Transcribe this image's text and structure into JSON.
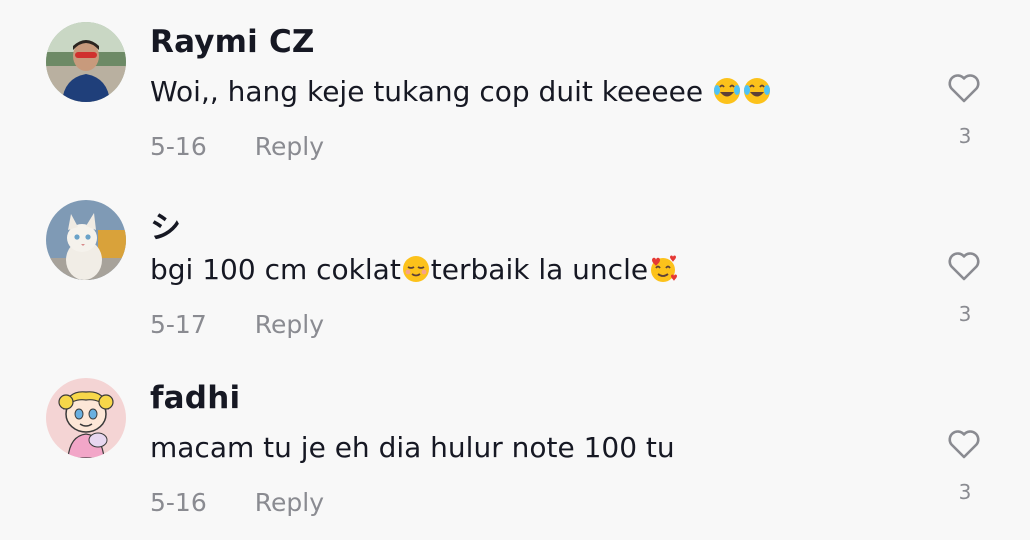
{
  "comments": [
    {
      "username": "Raymi CZ",
      "text": "Woi,, hang keje tukang cop duit keeeee",
      "text_emojis": [
        "face-with-tears-of-joy-emoji",
        "face-with-tears-of-joy-emoji"
      ],
      "date": "5-16",
      "reply_label": "Reply",
      "like_count": "3"
    },
    {
      "username": "シ",
      "text_before": "bgi 100 cm coklat",
      "text_middle": "terbaik la uncle",
      "text_emojis": [
        "relieved-face-emoji",
        "smiling-face-with-hearts-emoji"
      ],
      "date": "5-17",
      "reply_label": "Reply",
      "like_count": "3"
    },
    {
      "username": "fadhi",
      "text": "macam tu je eh dia hulur note 100 tu",
      "date": "5-16",
      "reply_label": "Reply",
      "like_count": "3"
    }
  ],
  "colors": {
    "background": "#f8f8f8",
    "primary_text": "#161823",
    "secondary_text": "#8a8b91",
    "heart_outline": "#8a8b91"
  }
}
